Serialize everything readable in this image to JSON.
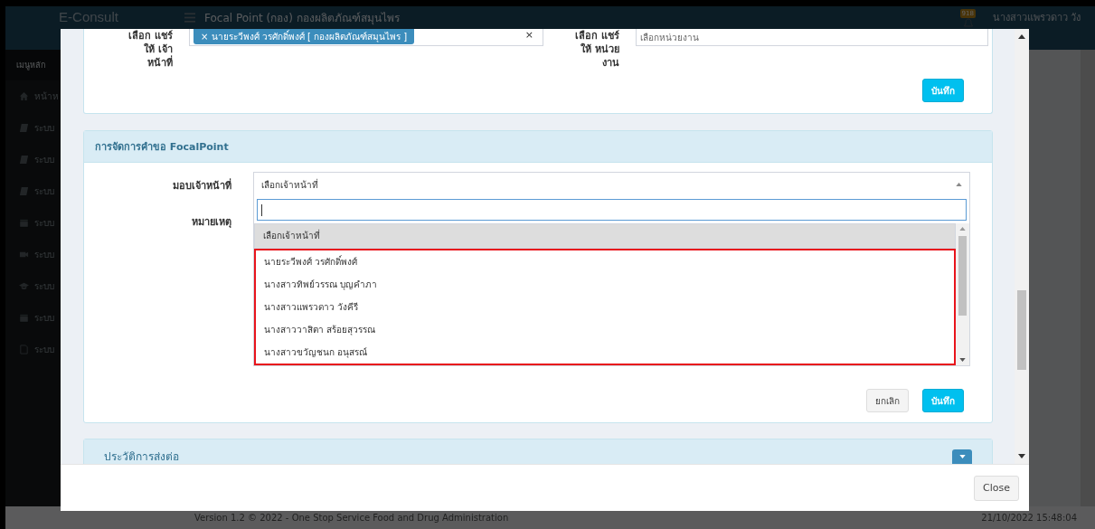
{
  "app": {
    "brand": "E-Consult",
    "page_title": "Focal Point (กอง) กองผลิตภัณฑ์สมุนไพร",
    "notification_count": "918",
    "user_name": "นางสาวแพรวดาว วัง",
    "sidebar": {
      "heading": "เมนูหลัก",
      "items": [
        {
          "kind": "home",
          "label": "หน้าห"
        },
        {
          "kind": "book",
          "label": "ระบบ"
        },
        {
          "kind": "book",
          "label": "ระบบ"
        },
        {
          "kind": "book",
          "label": "ระบบ"
        },
        {
          "kind": "calendar",
          "label": "ระบบ"
        },
        {
          "kind": "video",
          "label": "ระบบ"
        },
        {
          "kind": "cap",
          "label": "ระบบ"
        },
        {
          "kind": "calendar",
          "label": "ระบบ"
        },
        {
          "kind": "file",
          "label": "ระบบ"
        }
      ]
    },
    "footer": {
      "version": "Version 1.2 © 2022 - One Stop Service Food and Drug Administration",
      "timestamp": "21/10/2022 15:48:04"
    }
  },
  "modal": {
    "share_panel": {
      "staff_label": "เลือก แชร์ให้ เจ้าหน้าที่",
      "staff_tags": [
        {
          "remove": "×",
          "label": "นายระวีพงศ์ วรศักดิ์พงศ์ [ กองผลิตภัณฑ์สมุนไพร ]"
        }
      ],
      "clear_mark": "×",
      "unit_label": "เลือก แชร์ให้ หน่วยงาน",
      "unit_placeholder": "เลือกหน่วยงาน",
      "save_button": "บันทึก"
    },
    "manage_panel": {
      "title": "การจัดการคำขอ FocalPoint",
      "assign_label": "มอบเจ้าหน้าที่",
      "assign_value": "เลือกเจ้าหน้าที่",
      "note_label": "หมายเหตุ",
      "dropdown": {
        "expanded": true,
        "options": [
          {
            "label": "เลือกเจ้าหน้าที่",
            "selected": true,
            "highlighted": false
          },
          {
            "label": "นายระวีพงศ์ วรศักดิ์พงศ์",
            "selected": false,
            "highlighted": true
          },
          {
            "label": "นางสาวทิพย์วรรณ บุญคำภา",
            "selected": false,
            "highlighted": true
          },
          {
            "label": "นางสาวแพรวดาว วังคีรี",
            "selected": false,
            "highlighted": true
          },
          {
            "label": "นางสาววาสิตา สร้อยสุวรรณ",
            "selected": false,
            "highlighted": true
          },
          {
            "label": "นางสาวขวัญชนก อนุสรณ์",
            "selected": false,
            "highlighted": true
          }
        ]
      },
      "cancel_button": "ยกเลิก",
      "save_button": "บันทึก"
    },
    "history_panel": {
      "title": "ประวัติการส่งต่อ",
      "expanded": false
    },
    "close_button": "Close"
  }
}
